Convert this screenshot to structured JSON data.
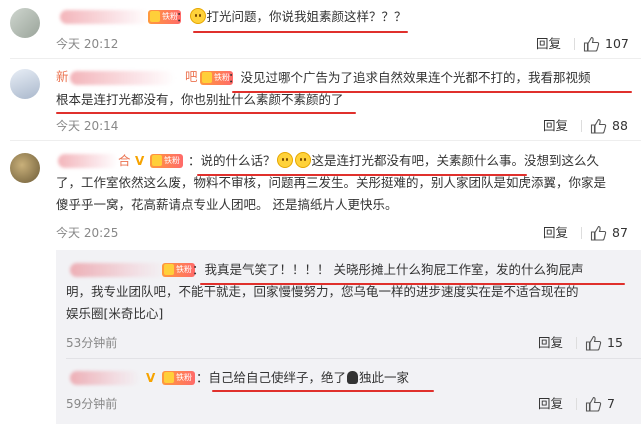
{
  "comments": [
    {
      "badge": "铁粉",
      "colon": "：",
      "text": "打光问题，你说我姐素颜这样？？？",
      "time": "今天 20:12",
      "reply": "回复",
      "likes": "107"
    },
    {
      "name_visible_prefix": "新",
      "name_visible_suffix": "吧",
      "badge": "铁粉",
      "colon": "：",
      "line1": "没见过哪个广告为了追求自然效果连个光都不打的，我看那视频",
      "line2": "根本是连打光都没有，你也别扯什么素颜不素颜的了",
      "time": "今天 20:14",
      "reply": "回复",
      "likes": "88"
    },
    {
      "name_visible_suffix": "合",
      "vip": "V",
      "badge": "铁粉",
      "colon": "：",
      "line1_a": "说的什么话？",
      "line1_b": "这是连打光都没有吧，关素颜什么事。没想到这么久",
      "line2": "了，工作室依然这么废，物料不审核，问题再三发生。关彤挺难的，别人家团队是如虎添翼，你家是",
      "line3": "傻乎乎一窝，花高薪请点专业人团吧。 还是搞纸片人更快乐。",
      "time": "今天 20:25",
      "reply": "回复",
      "likes": "87"
    }
  ],
  "replies": [
    {
      "badge": "铁粉",
      "colon": "：",
      "line1": "我真是气笑了！！！！ 关晓彤摊上什么狗屁工作室，发的什么狗屁声",
      "line2": "明，我专业团队吧，不能干就走，回家慢慢努力，您乌龟一样的进步速度实在是不适合现在的",
      "line3": "娱乐圈[米奇比心]",
      "time": "53分钟前",
      "reply": "回复",
      "likes": "15"
    },
    {
      "vip": "V",
      "badge": "铁粉",
      "colon": "：",
      "text_a": "自己给自己使绊子，绝了",
      "text_b": "独此一家",
      "time": "59分钟前",
      "reply": "回复",
      "likes": "7"
    }
  ],
  "icons": {
    "like": "thumbs-up-icon",
    "emoji": "smile-emoji",
    "hand": "hand-emoji"
  },
  "colors": {
    "underline": "#e0302c",
    "badge": "#ff7a45",
    "vip": "#f6a300"
  }
}
